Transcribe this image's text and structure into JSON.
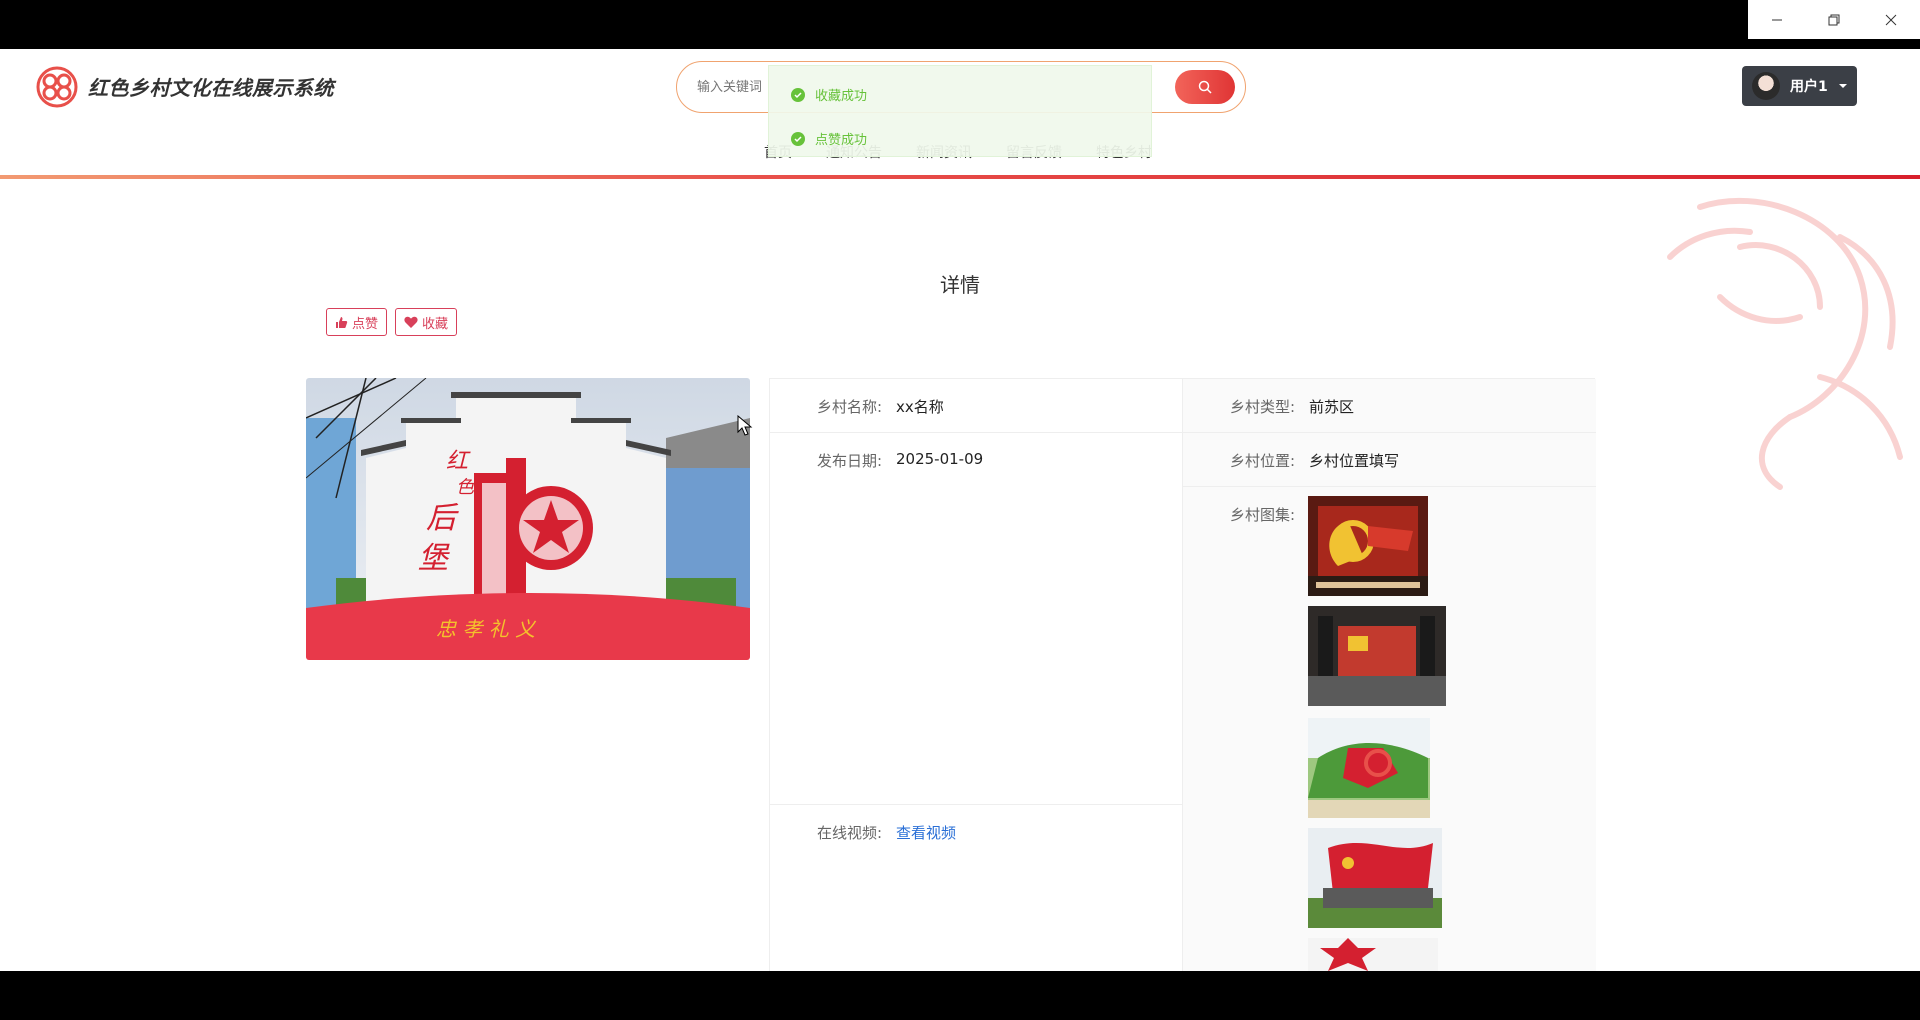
{
  "window": {
    "minimize_icon": "minimize-icon",
    "restore_icon": "restore-icon",
    "close_icon": "close-icon"
  },
  "header": {
    "site_title": "红色乡村文化在线展示系统",
    "search_placeholder": "输入关键词",
    "nav": [
      "首页",
      "通知公告",
      "新闻资讯",
      "留言反馈",
      "特色乡村"
    ],
    "user_label": "用户1"
  },
  "toasts": [
    "收藏成功",
    "点赞成功"
  ],
  "detail": {
    "title": "详情",
    "like_label": "点赞",
    "favorite_label": "收藏",
    "fields": {
      "name_label": "乡村名称:",
      "name_value": "xx名称",
      "type_label": "乡村类型:",
      "type_value": "前苏区",
      "date_label": "发布日期:",
      "date_value": "2025-01-09",
      "location_label": "乡村位置:",
      "location_value": "乡村位置填写",
      "gallery_label": "乡村图集:",
      "video_label": "在线视频:",
      "video_value": "查看视频"
    }
  },
  "colors": {
    "accent": "#e03535",
    "brand_pink": "#d8405a",
    "success": "#67c23a",
    "link": "#2a6fd6"
  }
}
